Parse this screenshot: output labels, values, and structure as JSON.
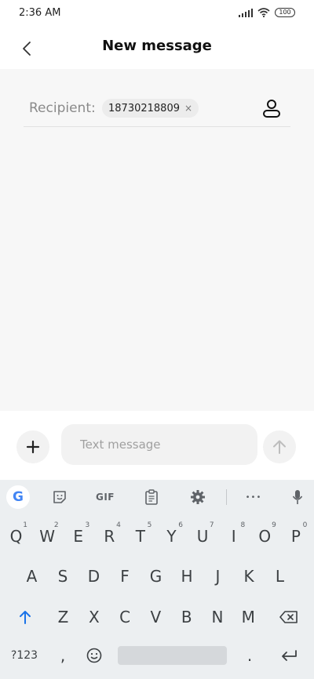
{
  "status_bar": {
    "time": "2:36 AM",
    "battery": "100"
  },
  "app_bar": {
    "title": "New message"
  },
  "recipient": {
    "label": "Recipient:",
    "chip_value": "18730218809",
    "chip_remove": "×"
  },
  "compose": {
    "placeholder": "Text message"
  },
  "keyboard": {
    "toolbar": {
      "gif_label": "GIF",
      "google_letter": "G",
      "more": "•••"
    },
    "row1": [
      {
        "key": "Q",
        "hint": "1"
      },
      {
        "key": "W",
        "hint": "2"
      },
      {
        "key": "E",
        "hint": "3"
      },
      {
        "key": "R",
        "hint": "4"
      },
      {
        "key": "T",
        "hint": "5"
      },
      {
        "key": "Y",
        "hint": "6"
      },
      {
        "key": "U",
        "hint": "7"
      },
      {
        "key": "I",
        "hint": "8"
      },
      {
        "key": "O",
        "hint": "9"
      },
      {
        "key": "P",
        "hint": "0"
      }
    ],
    "row2": [
      "A",
      "S",
      "D",
      "F",
      "G",
      "H",
      "J",
      "K",
      "L"
    ],
    "row3": [
      "Z",
      "X",
      "C",
      "V",
      "B",
      "N",
      "M"
    ],
    "row4": {
      "symbols": "?123",
      "comma": ",",
      "period": "."
    }
  },
  "colors": {
    "accent": "#1a73e8",
    "content_bg": "#f7f7f7",
    "keyboard_bg": "#eceff1"
  }
}
